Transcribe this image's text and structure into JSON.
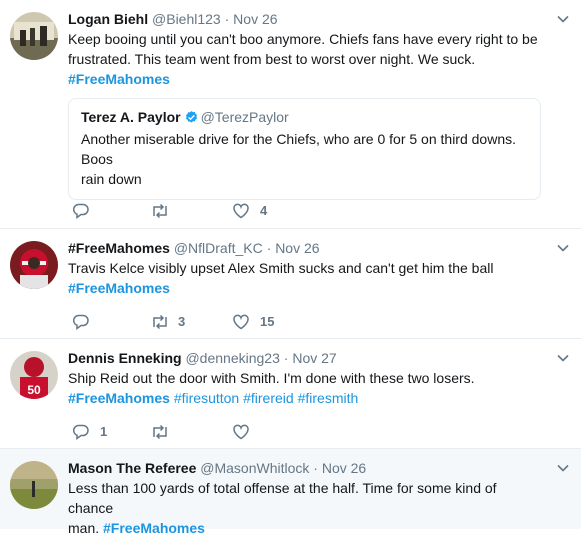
{
  "tweets": [
    {
      "name": "Logan Biehl",
      "handle": "@Biehl123",
      "sep": "·",
      "date": "Nov 26",
      "line1": "Keep booing until you can't boo anymore. Chiefs fans have every right to be",
      "line2": "frustrated. This team went from best to worst over night. We suck.",
      "hashtag": "#FreeMahomes",
      "quote": {
        "name": "Terez A. Paylor",
        "handle": "@TerezPaylor",
        "line1": "Another miserable drive for the Chiefs, who are 0 for 5 on third downs. Boos",
        "line2": "rain down"
      },
      "replies": "",
      "retweets": "",
      "likes": "4"
    },
    {
      "name": "#FreeMahomes",
      "handle": "@NflDraft_KC",
      "sep": "·",
      "date": "Nov 26",
      "line1": "Travis Kelce visibly upset Alex Smith sucks and can't get him the ball",
      "hashtag": "#FreeMahomes",
      "replies": "",
      "retweets": "3",
      "likes": "15"
    },
    {
      "name": "Dennis Enneking",
      "handle": "@denneking23",
      "sep": "·",
      "date": "Nov 27",
      "line1": "Ship Reid out the door with Smith. I'm done with these two losers.",
      "tags": [
        "#FreeMahomes",
        "#firesutton",
        "#firereid",
        "#firesmith"
      ],
      "replies": "1",
      "retweets": "",
      "likes": ""
    },
    {
      "name": "Mason The Referee",
      "handle": "@MasonWhitlock",
      "sep": "·",
      "date": "Nov 26",
      "line1": "Less than 100 yards of total offense at the half. Time for some kind of chance",
      "line2_prefix": "man.",
      "hashtag": "#FreeMahomes"
    }
  ],
  "icons": {
    "reply": "reply-icon",
    "retweet": "retweet-icon",
    "like": "heart-icon",
    "more": "chevron-down-icon",
    "verified": "verified-badge-icon"
  },
  "colors": {
    "link": "#1b95e0",
    "muted": "#657786",
    "text": "#14171a",
    "border": "#e6ecf0",
    "highlight_bg": "#f5f8fa"
  }
}
